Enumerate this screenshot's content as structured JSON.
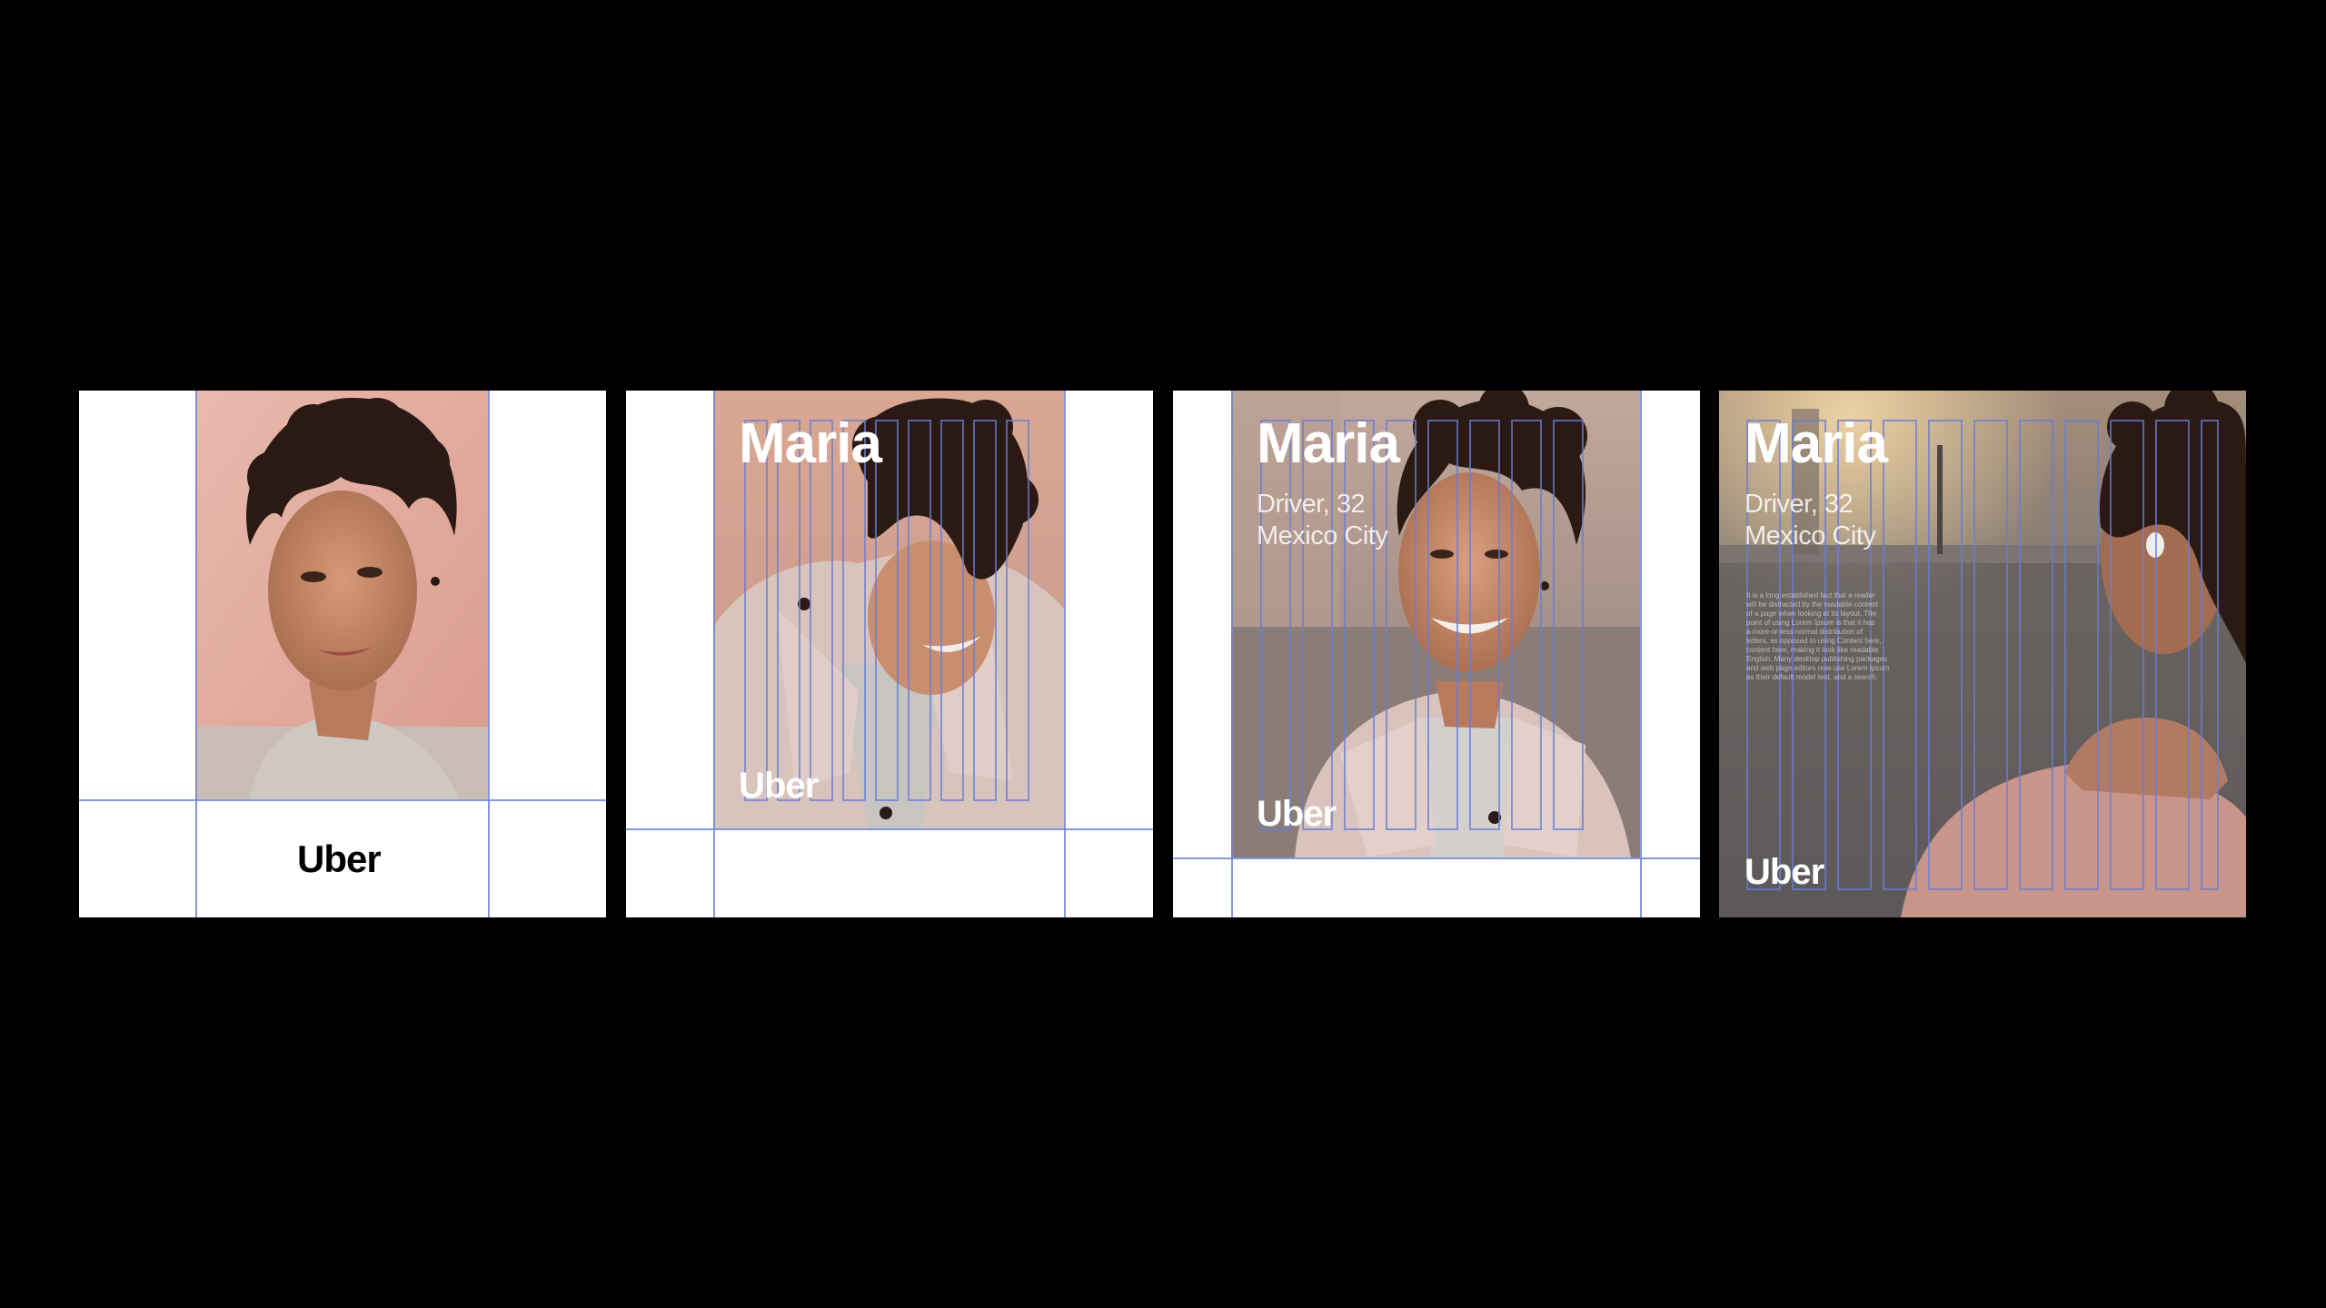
{
  "panels": [
    {
      "id": "panel-1",
      "logo": "Uber"
    },
    {
      "id": "panel-2",
      "name": "Maria",
      "logo": "Uber"
    },
    {
      "id": "panel-3",
      "name": "Maria",
      "role_age": "Driver, 32",
      "city": "Mexico City",
      "logo": "Uber"
    },
    {
      "id": "panel-4",
      "name": "Maria",
      "role_age": "Driver, 32",
      "city": "Mexico City",
      "body_lines": [
        "It is a long established fact that a reader",
        "will be distracted by the readable content",
        "of a page when looking at its layout. The",
        "point of using Lorem Ipsum is that it has",
        "a more-or-less normal distribution of",
        "letters, as opposed to using Content here,",
        "content here, making it look like readable",
        "English. Many desktop publishing packages",
        "and web page editors now use Lorem Ipsum",
        "as their default model text, and a search."
      ],
      "logo": "Uber"
    }
  ],
  "colors": {
    "background": "#000000",
    "panel": "#ffffff",
    "grid_guides": "#6f86d6"
  }
}
